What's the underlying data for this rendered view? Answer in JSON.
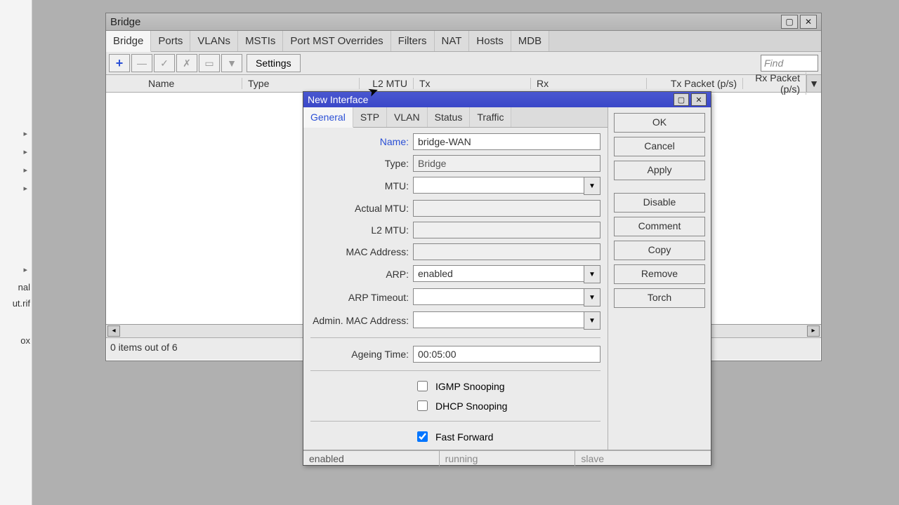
{
  "left_panel": {
    "labels": [
      "nal",
      "ut.rif",
      "ox"
    ]
  },
  "bridge_window": {
    "title": "Bridge",
    "tabs": [
      "Bridge",
      "Ports",
      "VLANs",
      "MSTIs",
      "Port MST Overrides",
      "Filters",
      "NAT",
      "Hosts",
      "MDB"
    ],
    "toolbar": {
      "settings_label": "Settings",
      "find_placeholder": "Find"
    },
    "columns": [
      "Name",
      "Type",
      "L2 MTU",
      "Tx",
      "Rx",
      "Tx Packet (p/s)",
      "Rx Packet (p/s)"
    ],
    "status": "0 items out of 6"
  },
  "dialog": {
    "title": "New Interface",
    "tabs": [
      "General",
      "STP",
      "VLAN",
      "Status",
      "Traffic"
    ],
    "labels": {
      "name": "Name:",
      "type": "Type:",
      "mtu": "MTU:",
      "actual_mtu": "Actual MTU:",
      "l2_mtu": "L2 MTU:",
      "mac": "MAC Address:",
      "arp": "ARP:",
      "arp_timeout": "ARP Timeout:",
      "admin_mac": "Admin. MAC Address:",
      "ageing": "Ageing Time:",
      "igmp": "IGMP Snooping",
      "dhcp": "DHCP Snooping",
      "ff": "Fast Forward"
    },
    "values": {
      "name": "bridge-WAN",
      "type": "Bridge",
      "mtu": "",
      "actual_mtu": "",
      "l2_mtu": "",
      "mac": "",
      "arp": "enabled",
      "arp_timeout": "",
      "admin_mac": "",
      "ageing": "00:05:00",
      "igmp_checked": false,
      "dhcp_checked": false,
      "ff_checked": true
    },
    "buttons": {
      "ok": "OK",
      "cancel": "Cancel",
      "apply": "Apply",
      "disable": "Disable",
      "comment": "Comment",
      "copy": "Copy",
      "remove": "Remove",
      "torch": "Torch"
    },
    "status": [
      "enabled",
      "running",
      "slave"
    ]
  }
}
